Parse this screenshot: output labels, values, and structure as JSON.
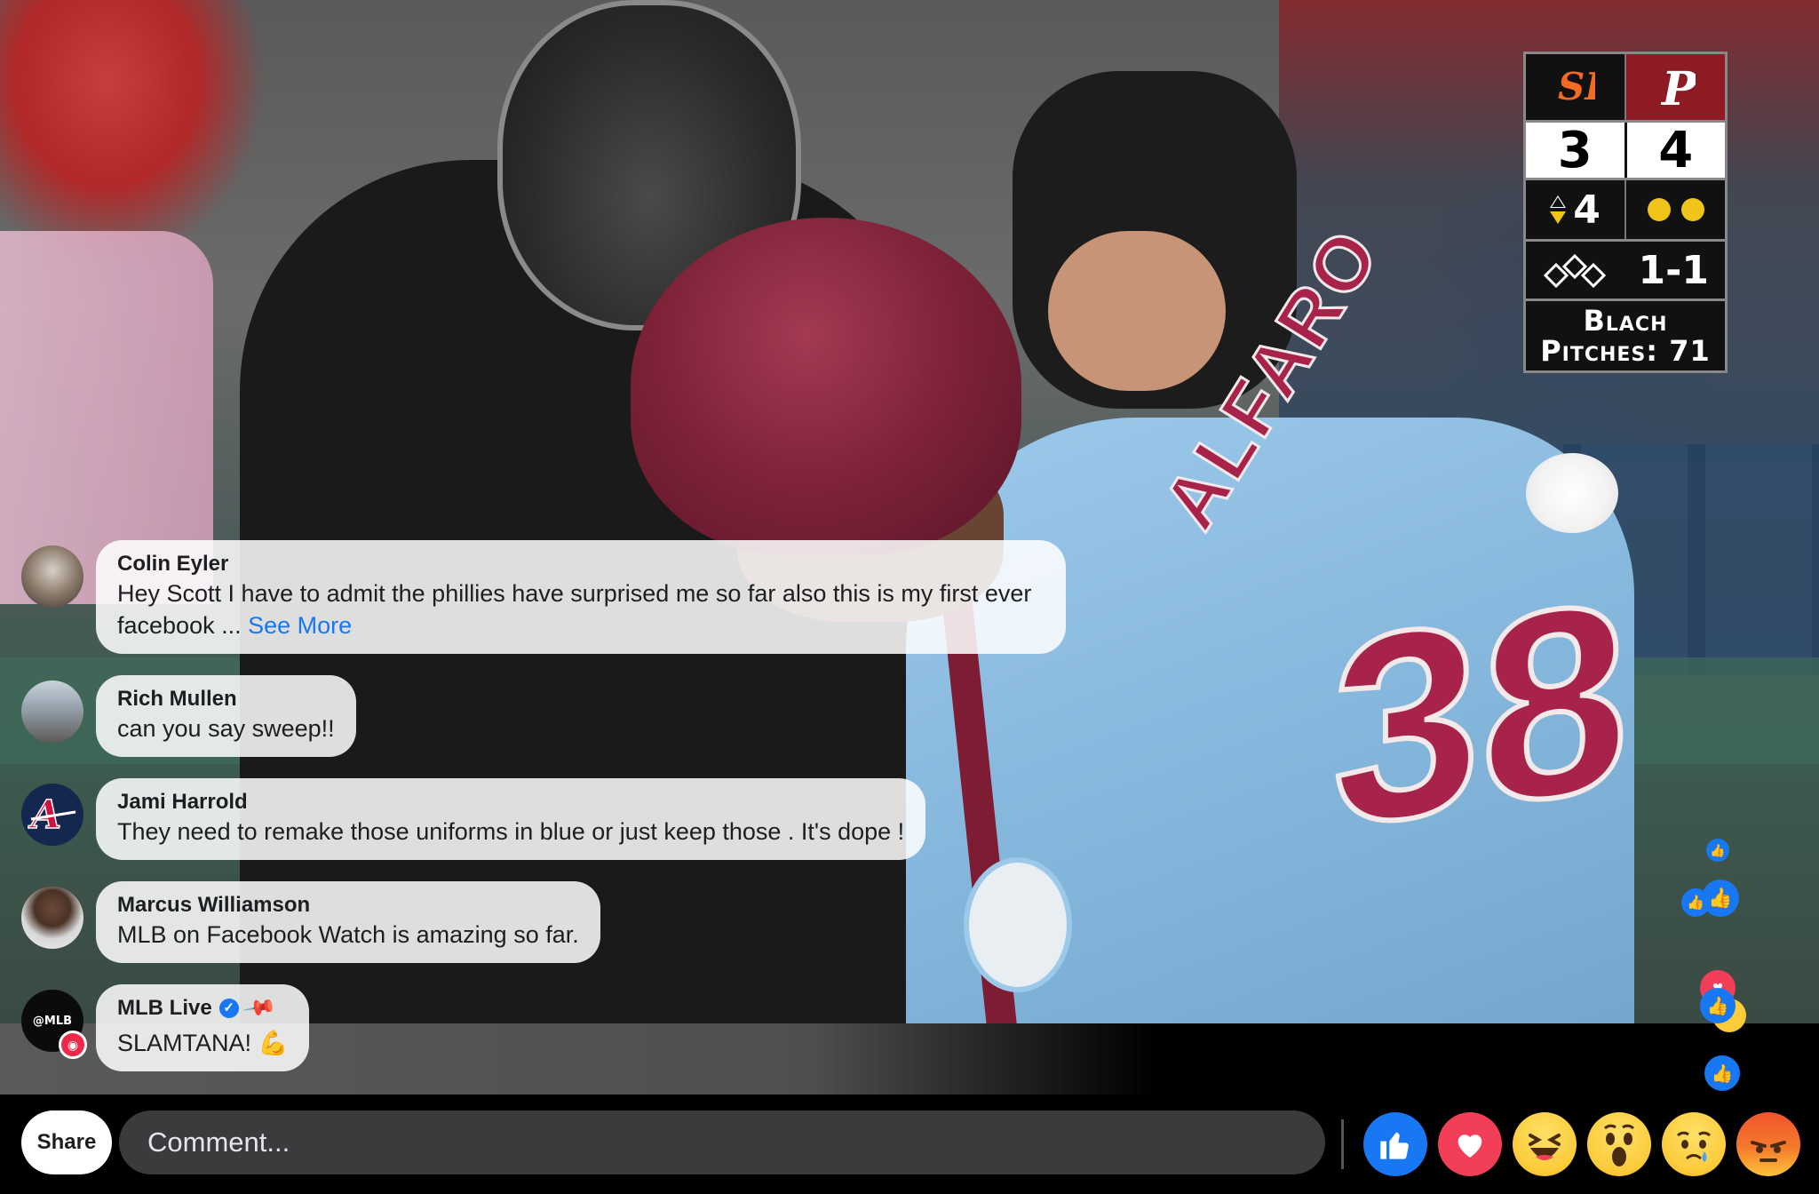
{
  "scoreboard": {
    "away_team_icon": "giants-sf-logo-icon",
    "home_team_icon": "phillies-p-logo-icon",
    "away_score": "3",
    "home_score": "4",
    "inning": "4",
    "inning_half": "bottom",
    "outs": 2,
    "count": "1-1",
    "pitcher_line1": "Blach",
    "pitcher_line2": "Pitches: 71",
    "colors": {
      "away": "#111111",
      "home": "#8e1b24",
      "out_dot": "#f0c419"
    }
  },
  "comments": [
    {
      "name": "Colin Eyler",
      "text": "Hey Scott I have to admit the phillies have surprised me so far also this is my first ever facebook ...",
      "see_more": "See More",
      "avatar_icon": "cat-photo-avatar"
    },
    {
      "name": "Rich Mullen",
      "text": "can you say sweep!!",
      "avatar_icon": "couple-photo-avatar"
    },
    {
      "name": "Jami Harrold",
      "text": "They need to remake those uniforms in blue or just keep those . It's dope !",
      "avatar_icon": "braves-logo-avatar"
    },
    {
      "name": "Marcus Williamson",
      "text": "MLB on Facebook Watch is amazing so far.",
      "avatar_icon": "person-photo-avatar"
    },
    {
      "name": "MLB Live",
      "text": "SLAMTANA! 💪",
      "avatar_text": "@MLB",
      "verified": true,
      "pinned": true
    }
  ],
  "bottom_bar": {
    "share_label": "Share",
    "comment_placeholder": "Comment...",
    "reactions": [
      "like",
      "love",
      "haha",
      "wow",
      "sad",
      "angry"
    ]
  },
  "colors": {
    "facebook_blue": "#1877f2",
    "love_red": "#f33e58",
    "input_bg": "#3a3b3c"
  }
}
